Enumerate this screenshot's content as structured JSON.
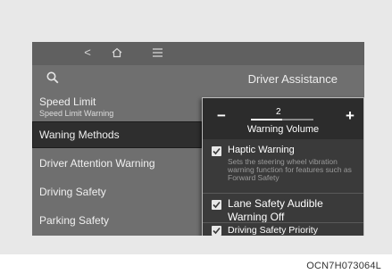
{
  "header": {
    "back_glyph": "<",
    "home_icon": "home-icon",
    "menu_icon": "menu-icon",
    "search_icon": "search-icon",
    "title": "Driver Assistance"
  },
  "menu": {
    "items": [
      {
        "label": "Speed Limit",
        "sub": "Speed Limit Warning"
      },
      {
        "label": "Waning Methods",
        "sub": ""
      },
      {
        "label": "Driver Attention Warning",
        "sub": ""
      },
      {
        "label": "Driving Safety",
        "sub": ""
      },
      {
        "label": "Parking Safety",
        "sub": ""
      }
    ]
  },
  "popup": {
    "volume": {
      "minus": "−",
      "plus": "+",
      "value": "2",
      "label": "Warning Volume",
      "level": 0.5
    },
    "options": [
      {
        "label": "Haptic Warning",
        "desc": "Sets the steering wheel vibration warning function for features such as Forward Safety",
        "checked": true
      },
      {
        "label": "Lane Safety Audible Warning Off",
        "desc": "",
        "checked": true
      },
      {
        "label": "Driving Safety Priority",
        "desc": "",
        "checked": true
      }
    ]
  },
  "figure_code": "OCN7H073064L",
  "colors": {
    "screen_bg": "#6f6f6f",
    "popup_bg": "#3a3a3a",
    "selected_bg": "#2e2e2e",
    "text": "#ffffff"
  }
}
